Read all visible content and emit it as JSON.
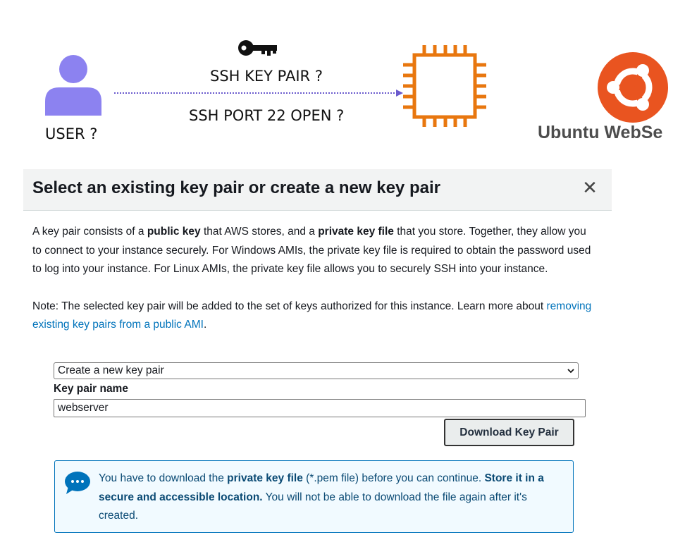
{
  "diagram": {
    "user_label": "USER ?",
    "ssh_key_label": "SSH KEY PAIR ?",
    "ssh_port_label": "SSH PORT 22 OPEN ?",
    "ubuntu_label": "Ubuntu WebSe",
    "icons": {
      "user": "user-icon",
      "key": "key-icon",
      "instance": "ec2-instance-icon",
      "ubuntu": "ubuntu-logo-icon"
    },
    "colors": {
      "user": "#8c82f0",
      "line": "#6a5acd",
      "instance": "#e8770f",
      "ubuntu": "#e95420"
    }
  },
  "modal": {
    "title": "Select an existing key pair or create a new key pair",
    "close_glyph": "✕",
    "description": {
      "part1": "A key pair consists of a ",
      "bold1": "public key",
      "part2": " that AWS stores, and a ",
      "bold2": "private key file",
      "part3": " that you store. Together, they allow you to connect to your instance securely. For Windows AMIs, the private key file is required to obtain the password used to log into your instance. For Linux AMIs, the private key file allows you to securely SSH into your instance."
    },
    "note": {
      "text": "Note: The selected key pair will be added to the set of keys authorized for this instance. Learn more about ",
      "link": "removing existing key pairs from a public AMI",
      "end": "."
    },
    "select": {
      "value": "Create a new key pair"
    },
    "keyname": {
      "label": "Key pair name",
      "value": "webserver"
    },
    "download_button": "Download Key Pair",
    "info": {
      "part1": "You have to download the ",
      "bold1": "private key file",
      "part2": " (*.pem file) before you can continue. ",
      "bold2": "Store it in a secure and accessible location.",
      "part3": " You will not be able to download the file again after it's created."
    },
    "colors": {
      "header_bg": "#f2f3f3",
      "link": "#0073bb",
      "info_bg": "#f1faff",
      "info_border": "#0073bb"
    }
  }
}
